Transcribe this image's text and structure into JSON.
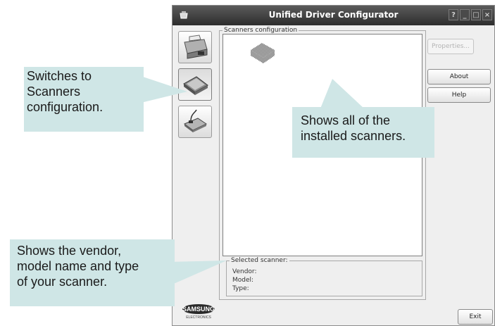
{
  "window": {
    "title": "Unified Driver Configurator",
    "title_buttons": [
      "?",
      "_",
      "□",
      "×"
    ]
  },
  "sidebar": {
    "items": [
      {
        "name": "printers",
        "icon": "printer-icon",
        "active": false
      },
      {
        "name": "scanners",
        "icon": "scanner-icon",
        "active": true
      },
      {
        "name": "ports",
        "icon": "port-icon",
        "active": false
      }
    ]
  },
  "scanners_group": {
    "label": "Scanners configuration",
    "list_items": [
      {
        "icon": "scanner-icon"
      }
    ]
  },
  "buttons": {
    "properties": "Properties...",
    "about": "About",
    "help": "Help",
    "exit": "Exit"
  },
  "selected_scanner": {
    "label": "Selected scanner:",
    "vendor": "Vendor:",
    "model": "Model:",
    "type": "Type:"
  },
  "logo": {
    "brand": "SAMSUNG",
    "sub": "ELECTRONICS"
  },
  "callouts": {
    "switches": [
      "Switches to",
      "Scanners",
      "configuration."
    ],
    "shows_all": [
      "Shows all of the",
      "installed scanners."
    ],
    "vendor": [
      "Shows the vendor,",
      "model name and type",
      "of your scanner."
    ]
  },
  "colors": {
    "callout_bg": "#cfe6e6",
    "titlebar": "#3b3b3b",
    "window_bg": "#efefef"
  }
}
